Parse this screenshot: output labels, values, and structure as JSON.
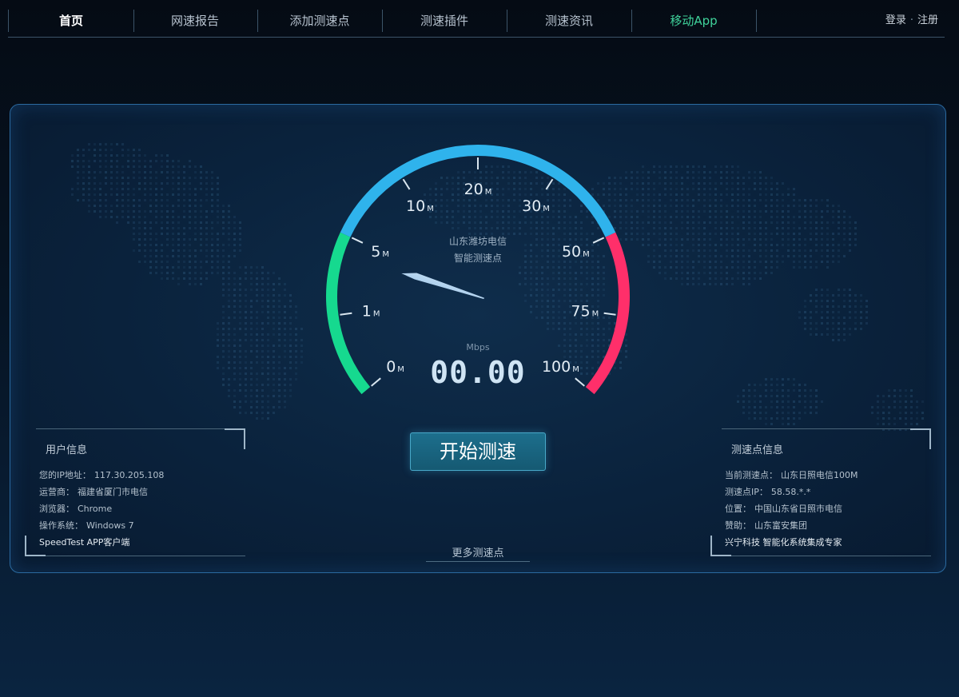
{
  "nav": {
    "items": [
      {
        "label": "首页",
        "name": "nav-home",
        "state": "current"
      },
      {
        "label": "网速报告",
        "name": "nav-speed-report"
      },
      {
        "label": "添加测速点",
        "name": "nav-add-node"
      },
      {
        "label": "测速插件",
        "name": "nav-plugin"
      },
      {
        "label": "测速资讯",
        "name": "nav-news"
      },
      {
        "label": "移动App",
        "name": "nav-mobile-app",
        "state": "highlighted"
      }
    ],
    "login": "登录",
    "separator": "·",
    "register": "注册"
  },
  "gauge": {
    "ticks": [
      {
        "label": "0",
        "unit": "M"
      },
      {
        "label": "1",
        "unit": "M"
      },
      {
        "label": "5",
        "unit": "M"
      },
      {
        "label": "10",
        "unit": "M"
      },
      {
        "label": "20",
        "unit": "M"
      },
      {
        "label": "30",
        "unit": "M"
      },
      {
        "label": "50",
        "unit": "M"
      },
      {
        "label": "75",
        "unit": "M"
      },
      {
        "label": "100",
        "unit": "M"
      }
    ],
    "provider_line1": "山东潍坊电信",
    "provider_line2": "智能测速点",
    "unit_label": "Mbps",
    "speed_value": "00.00",
    "needle_tick_position": 1.75,
    "colors": {
      "low": "#16d98f",
      "mid": "#2fb3ec",
      "high": "#ff2f6a",
      "needle": "#c7ddf2"
    }
  },
  "start_button": "开始测速",
  "more_nodes": "更多测速点",
  "user_info": {
    "title": "用户信息",
    "rows": [
      {
        "label": "您的IP地址：",
        "value": "117.30.205.108"
      },
      {
        "label": "运营商：",
        "value": "福建省厦门市电信"
      },
      {
        "label": "浏览器：",
        "value": "Chrome"
      },
      {
        "label": "操作系统：",
        "value": "Windows 7"
      },
      {
        "label": "SpeedTest APP客户端",
        "value": ""
      }
    ]
  },
  "node_info": {
    "title": "测速点信息",
    "rows": [
      {
        "label": "当前测速点：",
        "value": "山东日照电信100M"
      },
      {
        "label": "测速点IP：",
        "value": "58.58.*.*"
      },
      {
        "label": "位置：",
        "value": "中国山东省日照市电信"
      },
      {
        "label": "赞助：",
        "value": "山东富安集团"
      },
      {
        "label": "兴宁科技 智能化系统集成专家",
        "value": ""
      }
    ]
  }
}
